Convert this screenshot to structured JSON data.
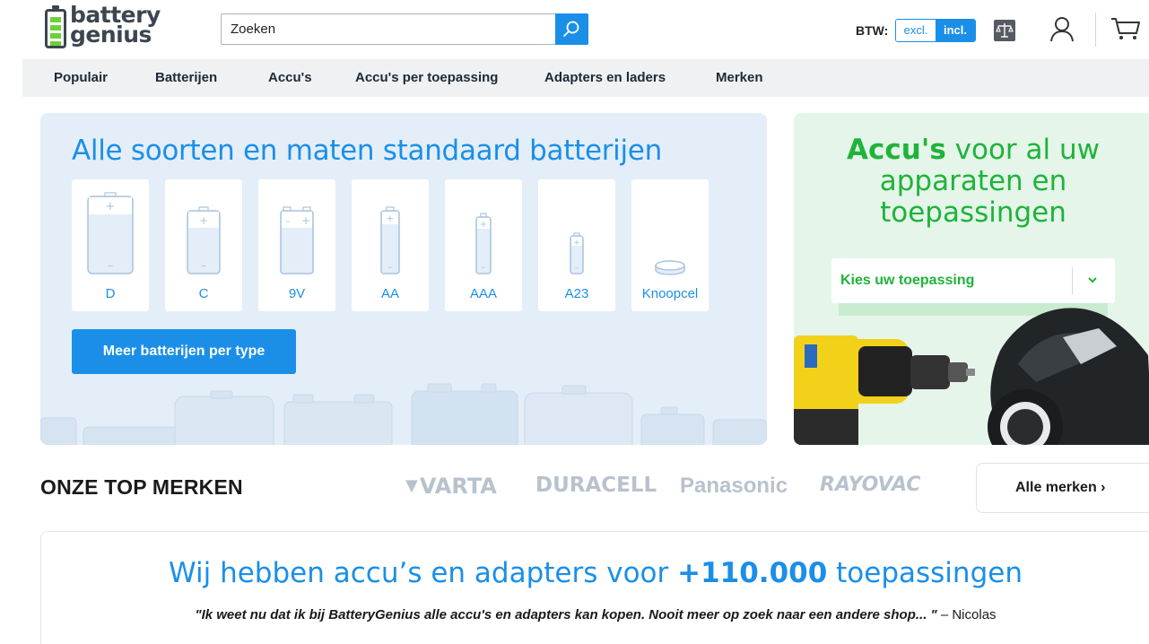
{
  "header": {
    "logo_line1": "battery",
    "logo_line2": "genius",
    "search_placeholder": "Zoeken",
    "btw_label": "BTW:",
    "btw_excl": "excl.",
    "btw_incl": "incl."
  },
  "nav": {
    "items": [
      "Populair",
      "Batterijen",
      "Accu's",
      "Accu's per toepassing",
      "Adapters en laders",
      "Merken"
    ]
  },
  "hero_left": {
    "title": "Alle soorten en maten standaard batterijen",
    "batteries": [
      "D",
      "C",
      "9V",
      "AA",
      "AAA",
      "A23",
      "Knoopcel"
    ],
    "button": "Meer batterijen per type"
  },
  "hero_right": {
    "title_bold": "Accu's",
    "title_rest": " voor al uw apparaten en toepassingen",
    "select_placeholder": "Kies uw toepassing"
  },
  "brands": {
    "title": "ONZE TOP MERKEN",
    "logos": [
      "VARTA",
      "DURACELL",
      "Panasonic",
      "RAYOVAC"
    ],
    "all_link": "Alle merken ›"
  },
  "banner": {
    "title_pre": "Wij hebben accu’s en adapters voor ",
    "title_bold": "+110.000",
    "title_post": " toepassingen",
    "quote": "\"Ik weet nu dat ik bij BatteryGenius alle accu's en adapters kan kopen. Nooit meer op zoek naar een andere shop... \"",
    "quote_author": " – Nicolas"
  },
  "colors": {
    "accent": "#1b8fe8",
    "green": "#1fb33a"
  },
  "icons": {
    "search": "search-icon",
    "compare": "compare-icon",
    "account": "account-icon",
    "cart": "cart-icon"
  }
}
